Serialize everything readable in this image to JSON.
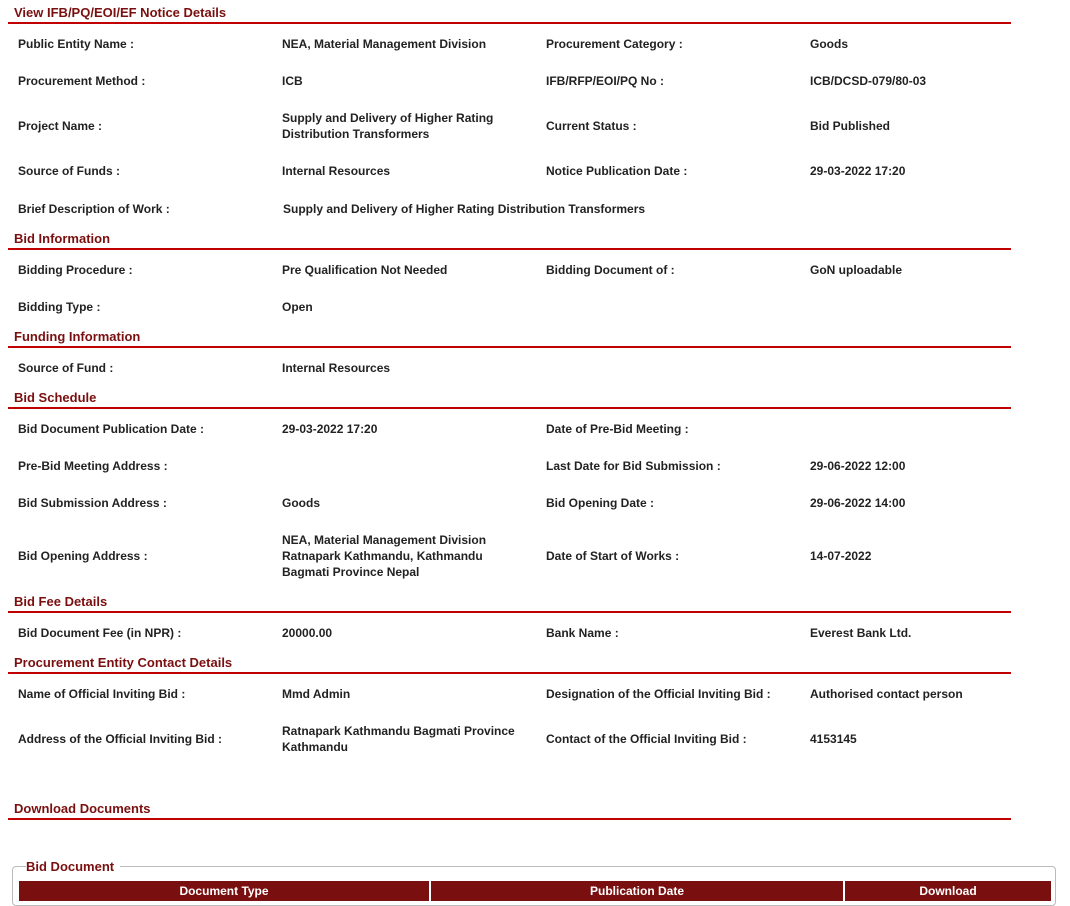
{
  "sections": {
    "notice": {
      "title": "View IFB/PQ/EOI/EF Notice Details",
      "public_entity_label": "Public Entity Name :",
      "public_entity_value": "NEA, Material Management Division",
      "procurement_category_label": "Procurement Category :",
      "procurement_category_value": "Goods",
      "procurement_method_label": "Procurement Method :",
      "procurement_method_value": "ICB",
      "ifb_no_label": "IFB/RFP/EOI/PQ No :",
      "ifb_no_value": "ICB/DCSD-079/80-03",
      "project_name_label": "Project Name :",
      "project_name_value": "Supply and Delivery of Higher Rating Distribution Transformers",
      "current_status_label": "Current Status :",
      "current_status_value": "Bid Published",
      "source_funds_label": "Source of Funds :",
      "source_funds_value": "Internal Resources",
      "notice_pub_date_label": "Notice Publication Date :",
      "notice_pub_date_value": "29-03-2022 17:20",
      "brief_desc_label": "Brief Description of Work :",
      "brief_desc_value": "Supply and Delivery of Higher Rating Distribution Transformers"
    },
    "bid_info": {
      "title": "Bid Information",
      "bidding_procedure_label": "Bidding Procedure :",
      "bidding_procedure_value": "Pre Qualification Not Needed",
      "bidding_document_label": "Bidding Document of :",
      "bidding_document_value": "GoN uploadable",
      "bidding_type_label": "Bidding Type :",
      "bidding_type_value": "Open"
    },
    "funding": {
      "title": "Funding Information",
      "source_fund_label": "Source of Fund :",
      "source_fund_value": "Internal Resources"
    },
    "schedule": {
      "title": "Bid Schedule",
      "doc_pub_date_label": "Bid Document Publication Date :",
      "doc_pub_date_value": "29-03-2022 17:20",
      "prebid_date_label": "Date of Pre-Bid Meeting :",
      "prebid_date_value": "",
      "prebid_address_label": "Pre-Bid Meeting Address :",
      "prebid_address_value": "",
      "last_date_label": "Last Date for Bid Submission :",
      "last_date_value": "29-06-2022 12:00",
      "submission_address_label": "Bid Submission Address :",
      "submission_address_value": "Goods",
      "opening_date_label": "Bid Opening Date :",
      "opening_date_value": "29-06-2022 14:00",
      "opening_address_label": "Bid Opening Address :",
      "opening_address_line1": "NEA, Material Management Division",
      "opening_address_line2": "Ratnapark Kathmandu, Kathmandu",
      "opening_address_line3": "Bagmati Province Nepal",
      "start_works_label": "Date of Start of Works :",
      "start_works_value": "14-07-2022"
    },
    "fee": {
      "title": "Bid Fee Details",
      "doc_fee_label": "Bid Document Fee (in NPR) :",
      "doc_fee_value": "20000.00",
      "bank_name_label": "Bank Name :",
      "bank_name_value": "Everest Bank Ltd."
    },
    "contact": {
      "title": "Procurement Entity Contact Details",
      "official_name_label": "Name of Official Inviting Bid :",
      "official_name_value": "Mmd Admin",
      "designation_label": "Designation of the Official Inviting Bid :",
      "designation_value": "Authorised contact person",
      "address_label": "Address of the Official Inviting Bid :",
      "address_value": "Ratnapark Kathmandu Bagmati Province Kathmandu",
      "contact_label": "Contact of the Official Inviting Bid :",
      "contact_value": "4153145"
    },
    "download": {
      "title": "Download Documents",
      "legend": "Bid Document",
      "columns": [
        "Document Type",
        "Publication Date",
        "Download"
      ]
    }
  },
  "colors": {
    "section_title": "#7a0f0f",
    "rule": "#c00000",
    "table_header_bg": "#7a0f0f"
  }
}
